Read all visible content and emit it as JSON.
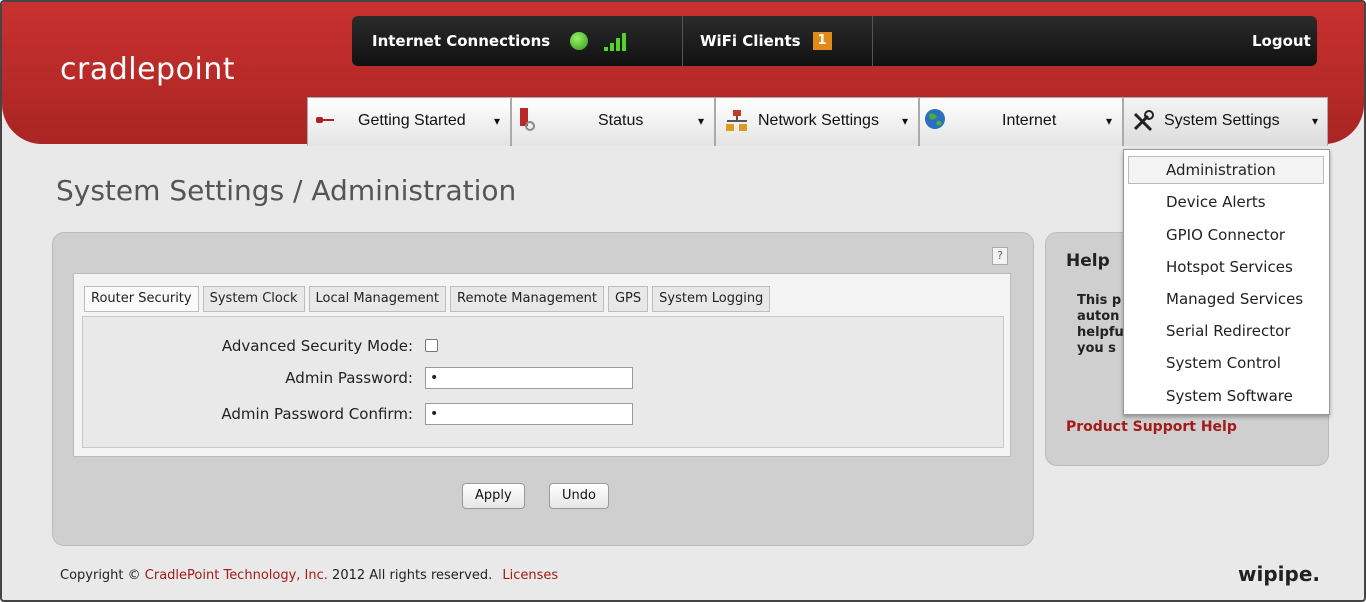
{
  "brand": {
    "logo": "cradlepoint",
    "footer_logo": "wipipe."
  },
  "topbar": {
    "internet_connections": "Internet Connections",
    "wifi_clients": "WiFi Clients",
    "wifi_clients_count": "1",
    "logout": "Logout"
  },
  "nav": {
    "tabs": [
      {
        "label": "Getting Started",
        "icon": "key-icon"
      },
      {
        "label": "Status",
        "icon": "status-icon"
      },
      {
        "label": "Network Settings",
        "icon": "network-icon"
      },
      {
        "label": "Internet",
        "icon": "globe-icon"
      },
      {
        "label": "System Settings",
        "icon": "tools-icon"
      }
    ],
    "arrow": "▾"
  },
  "page": {
    "title": "System Settings / Administration"
  },
  "panel": {
    "help_q": "?",
    "tabs": [
      "Router Security",
      "System Clock",
      "Local Management",
      "Remote Management",
      "GPS",
      "System Logging"
    ],
    "active_tab": "Router Security",
    "fields": {
      "advanced_security_label": "Advanced Security Mode:",
      "admin_password_label": "Admin Password:",
      "admin_password_value": "•",
      "admin_password_confirm_label": "Admin Password Confirm:",
      "admin_password_confirm_value": "•"
    },
    "apply": "Apply",
    "undo": "Undo"
  },
  "help": {
    "title": "Help",
    "lines": [
      "This p",
      "auton",
      "helpfu",
      "you s"
    ],
    "product_support": "Product Support Help"
  },
  "dropdown": {
    "items": [
      "Administration",
      "Device Alerts",
      "GPIO Connector",
      "Hotspot Services",
      "Managed Services",
      "Serial Redirector",
      "System Control",
      "System Software"
    ]
  },
  "footer": {
    "copyright_prefix": "Copyright ©",
    "company": "CradlePoint Technology, Inc.",
    "copyright_suffix": "2012 All rights reserved.",
    "licenses": "Licenses"
  },
  "colors": {
    "brand_red": "#b02a28",
    "link_red": "#a31a1a",
    "topbar": "#1e1e1e"
  }
}
